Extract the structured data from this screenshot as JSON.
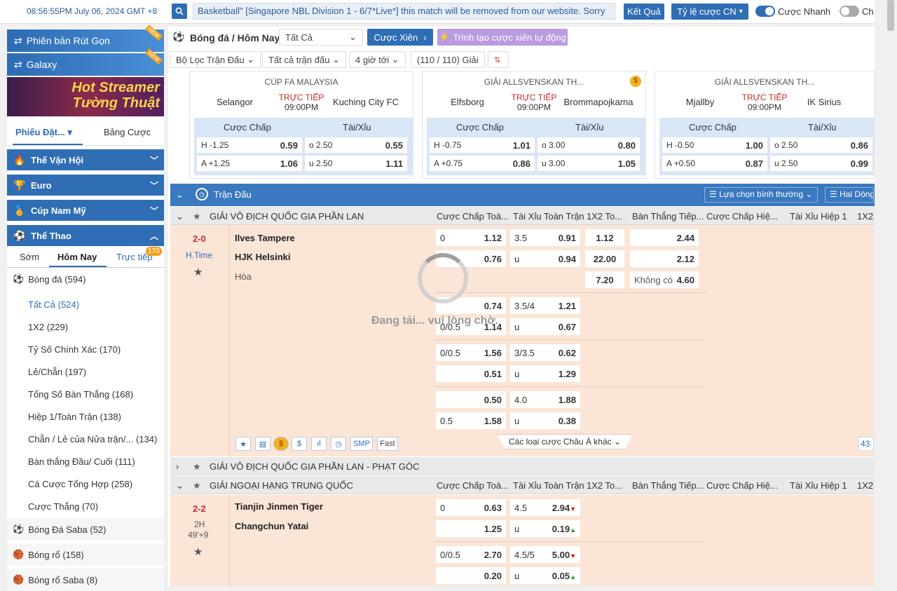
{
  "topbar": {
    "clock": "08:56:55PM July 06, 2024 GMT +8",
    "ticker": "Basketball\" [Singapore NBL Division 1 - 6/7*Live*] this match will be removed from our website. Sorry",
    "results_label": "Kết Quả",
    "odds_type_label": "Tỷ lệ cược CN",
    "quick_bet_label": "Cược Nhanh",
    "other_toggle_label": "Ch"
  },
  "sidebar": {
    "banner_lite": "Phiên bản Rút Gọn",
    "banner_galaxy": "Galaxy",
    "new_tag": "NEW",
    "streamer_line1": "Hot Streamer",
    "streamer_line2": "Tường Thuật",
    "slip_tab": "Phiếu Đặt...",
    "sheet_tab": "Bảng Cược",
    "cats": [
      "Thế Vận Hội",
      "Euro",
      "Cúp Nam Mỹ",
      "Thể Thao"
    ],
    "subtabs": [
      "Sớm",
      "Hôm Nay",
      "Trực tiếp"
    ],
    "live_count": "170",
    "football": "Bóng đá  (594)",
    "sub_items": [
      "Tất Cả  (524)",
      "1X2  (229)",
      "Tỷ Số Chính Xác  (170)",
      "Lẻ/Chẵn  (197)",
      "Tổng Số Bàn Thắng  (168)",
      "Hiệp 1/Toàn Trận  (138)",
      "Chẵn / Lẻ của Nửa trận/...  (134)",
      "Bàn thắng Đầu/ Cuối  (111)",
      "Cá Cược Tổng Hợp  (258)",
      "Cược Thắng  (70)"
    ],
    "sports": [
      "Bóng Đá Saba  (52)",
      "Bóng rổ  (158)",
      "Bóng rổ Saba  (8)"
    ]
  },
  "main": {
    "title": "Bóng đá / Hôm Nay",
    "select_all": "Tất Cả",
    "parlay": "Cược Xiên",
    "parlay_builder": "Trình tạo cược xiên tự động",
    "filters": [
      "Bộ Lọc Trận Đấu",
      "Tất cả trận đấu",
      "4 giờ tới",
      "(110 / 110) Giải"
    ],
    "featured": [
      {
        "league": "CÚP FA MALAYSIA",
        "home": "Selangor",
        "away": "Kuching City FC",
        "live": "TRỰC TIẾP",
        "time": "09:00PM",
        "hdp_label": "Cược Chấp",
        "ou_label": "Tài/Xỉu",
        "h_line": "H -1.25",
        "h_odd": "0.59",
        "a_line": "A +1.25",
        "a_odd": "1.06",
        "o_line": "o 2.50",
        "o_odd": "0.55",
        "u_line": "u 2.50",
        "u_odd": "1.11"
      },
      {
        "league": "GIẢI ALLSVENSKAN TH...",
        "home": "Elfsborg",
        "away": "Brommapojkarna",
        "live": "TRỰC TIẾP",
        "time": "09:00PM",
        "hdp_label": "Cược Chấp",
        "ou_label": "Tài/Xỉu",
        "h_line": "H -0.75",
        "h_odd": "1.01",
        "a_line": "A +0.75",
        "a_odd": "0.86",
        "o_line": "o 3.00",
        "o_odd": "0.80",
        "u_line": "u 3.00",
        "u_odd": "1.05"
      },
      {
        "league": "GIẢI ALLSVENSKAN TH...",
        "home": "Mjallby",
        "away": "IK Sirius",
        "live": "TRỰC TIẾP",
        "time": "09:00PM",
        "hdp_label": "Cược Chấp",
        "ou_label": "Tài/Xỉu",
        "h_line": "H -0.50",
        "h_odd": "1.00",
        "a_line": "A +0.50",
        "a_odd": "0.87",
        "o_line": "o 2.50",
        "o_odd": "0.86",
        "u_line": "u 2.50",
        "u_odd": "0.99"
      }
    ],
    "table_head": "Trận Đấu",
    "view_select": "Lựa chọn bình thường",
    "two_col": "Hai Dòng",
    "col_heads": [
      "Cược Chấp Toà...",
      "Tài Xỉu Toàn Trận",
      "1X2 To...",
      "Bàn Thắng Tiếp...",
      "Cược Chấp Hiệ...",
      "Tài Xỉu Hiệp 1",
      "1X2"
    ],
    "league1": "GIẢI VÔ ĐỊCH QUỐC GIA PHẦN LAN",
    "league2": "GIẢI VÔ ĐỊCH QUỐC GIA PHẦN LAN - PHẠT GÓC",
    "league3": "GIẢI NGOẠI HẠNG TRUNG QUỐC",
    "match1": {
      "score": "2-0",
      "status": "H.Time",
      "home": "Ilves Tampere",
      "away": "HJK Helsinki",
      "draw": "Hòa",
      "loading": "Đang tải... vui lòng chờ.",
      "rows": [
        [
          "0",
          "1.12",
          "3.5",
          "0.91",
          "1.12",
          "",
          "2.44"
        ],
        [
          "",
          "0.76",
          "u",
          "0.94",
          "22.00",
          "",
          "2.12"
        ],
        [
          "",
          "",
          "",
          "",
          "7.20",
          "Không có",
          "4.60"
        ]
      ],
      "alt1": [
        [
          "",
          "0.74",
          "3.5/4",
          "1.21"
        ],
        [
          "0/0.5",
          "1.14",
          "u",
          "0.67"
        ]
      ],
      "alt2": [
        [
          "0/0.5",
          "1.56",
          "3/3.5",
          "0.62"
        ],
        [
          "",
          "0.51",
          "u",
          "1.29"
        ]
      ],
      "alt3": [
        [
          "",
          "0.50",
          "4.0",
          "1.88"
        ],
        [
          "0.5",
          "1.58",
          "u",
          "0.38"
        ]
      ],
      "more_asian": "Các loại cược Châu Á khác",
      "more_count": "43",
      "icon_labels": [
        "★",
        "▤",
        "$",
        "$",
        "ıl",
        "◷",
        "SMP",
        "Fast"
      ]
    },
    "match2": {
      "score": "2-2",
      "period": "2H",
      "minute": "49'+9",
      "home": "Tianjin Jinmen Tiger",
      "away": "Changchun Yatai",
      "rows": [
        [
          "0",
          "0.63",
          "4.5",
          "2.94"
        ],
        [
          "",
          "1.25",
          "u",
          "0.19"
        ],
        [
          "0/0.5",
          "2.70",
          "4.5/5",
          "5.00"
        ],
        [
          "",
          "0.20",
          "u",
          "0.05"
        ]
      ]
    }
  },
  "colors": {
    "accent": "#2f6db4",
    "live": "#c42a2a",
    "match_bg": "#fbe5d6"
  }
}
